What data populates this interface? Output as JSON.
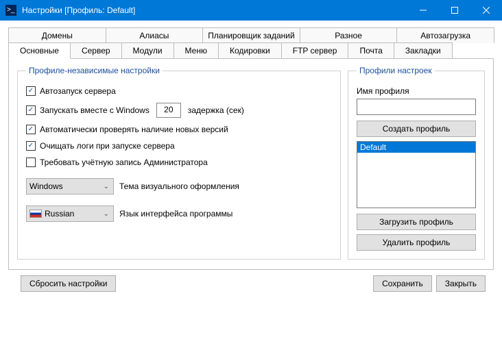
{
  "title": "Настройки [Профиль: Default]",
  "tabs_row1": {
    "t0": "Домены",
    "t1": "Алиасы",
    "t2": "Планировщик заданий",
    "t3": "Разное",
    "t4": "Автозагрузка"
  },
  "tabs_row2": {
    "t0": "Основные",
    "t1": "Сервер",
    "t2": "Модули",
    "t3": "Меню",
    "t4": "Кодировки",
    "t5": "FTP сервер",
    "t6": "Почта",
    "t7": "Закладки"
  },
  "left": {
    "legend": "Профиле-независимые настройки",
    "autostart": "Автозапуск сервера",
    "with_windows": "Запускать вместе с Windows",
    "delay_value": "20",
    "delay_label": "задержка (сек)",
    "check_updates": "Автоматически проверять наличие новых версий",
    "clear_logs": "Очищать логи при запуске сервера",
    "require_admin": "Требовать учётную запись Администратора",
    "theme_value": "Windows",
    "theme_label": "Тема визуального оформления",
    "lang_value": "Russian",
    "lang_label": "Язык интерфейса программы"
  },
  "right": {
    "legend": "Профили настроек",
    "name_label": "Имя профиля",
    "create": "Создать профиль",
    "selected_profile": "Default",
    "load": "Загрузить профиль",
    "delete": "Удалить профиль"
  },
  "bottom": {
    "reset": "Сбросить настройки",
    "save": "Сохранить",
    "close": "Закрыть"
  }
}
